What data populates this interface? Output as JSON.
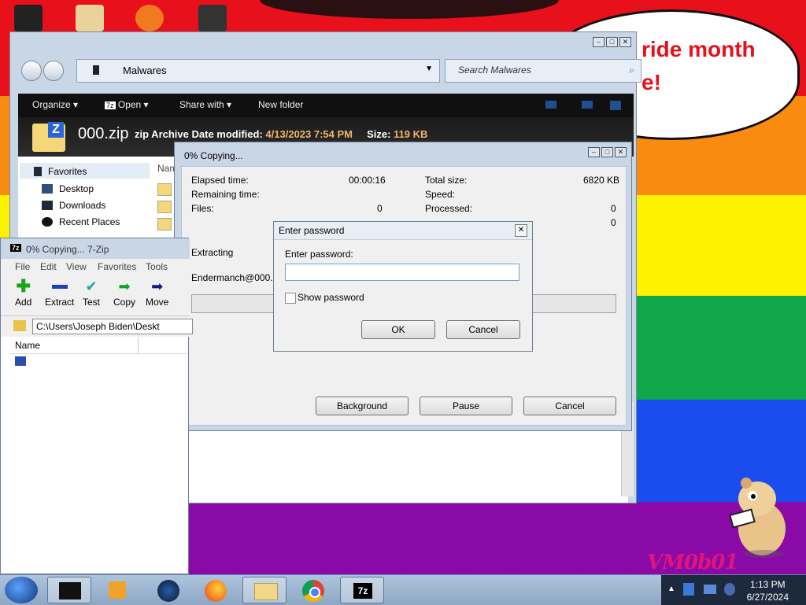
{
  "desktop": {
    "banner_line1": "ride month",
    "banner_line2": "e!",
    "signature": "VM0b01"
  },
  "explorer": {
    "address": "Malwares",
    "search_placeholder": "Search Malwares",
    "toolbar": {
      "organize": "Organize",
      "open": "Open",
      "share_with": "Share with",
      "new_folder": "New folder"
    },
    "details": {
      "file_name": "000.zip",
      "file_type": "zip Archive",
      "modified_label": "Date modified:",
      "modified_value": "4/13/2023 7:54 PM",
      "size_label": "Size:",
      "size_value": "119 KB"
    },
    "nav": {
      "favorites": "Favorites",
      "desktop": "Desktop",
      "downloads": "Downloads",
      "recent": "Recent Places"
    },
    "column_name": "Nam"
  },
  "copy_dialog": {
    "title": "0% Copying...",
    "elapsed_label": "Elapsed time:",
    "elapsed_value": "00:00:16",
    "remaining_label": "Remaining time:",
    "files_label": "Files:",
    "files_value": "0",
    "total_label": "Total size:",
    "total_value": "6820 KB",
    "speed_label": "Speed:",
    "processed_label": "Processed:",
    "processed_value": "0",
    "row4_value": "0",
    "extracting": "Extracting",
    "current_file": "Endermanch@000.exe",
    "buttons": {
      "background": "Background",
      "pause": "Pause",
      "cancel": "Cancel"
    }
  },
  "sevenzip": {
    "title": "0% Copying... 7-Zip",
    "menu": [
      "File",
      "Edit",
      "View",
      "Favorites",
      "Tools"
    ],
    "tools": [
      "Add",
      "Extract",
      "Test",
      "Copy",
      "Move"
    ],
    "path": "C:\\Users\\Joseph Biden\\Deskt",
    "column_name": "Name"
  },
  "password_dialog": {
    "title": "Enter password",
    "label": "Enter password:",
    "value": "",
    "show_password": "Show password",
    "ok": "OK",
    "cancel": "Cancel"
  },
  "taskbar": {
    "time": "1:13 PM",
    "date": "6/27/2024"
  }
}
